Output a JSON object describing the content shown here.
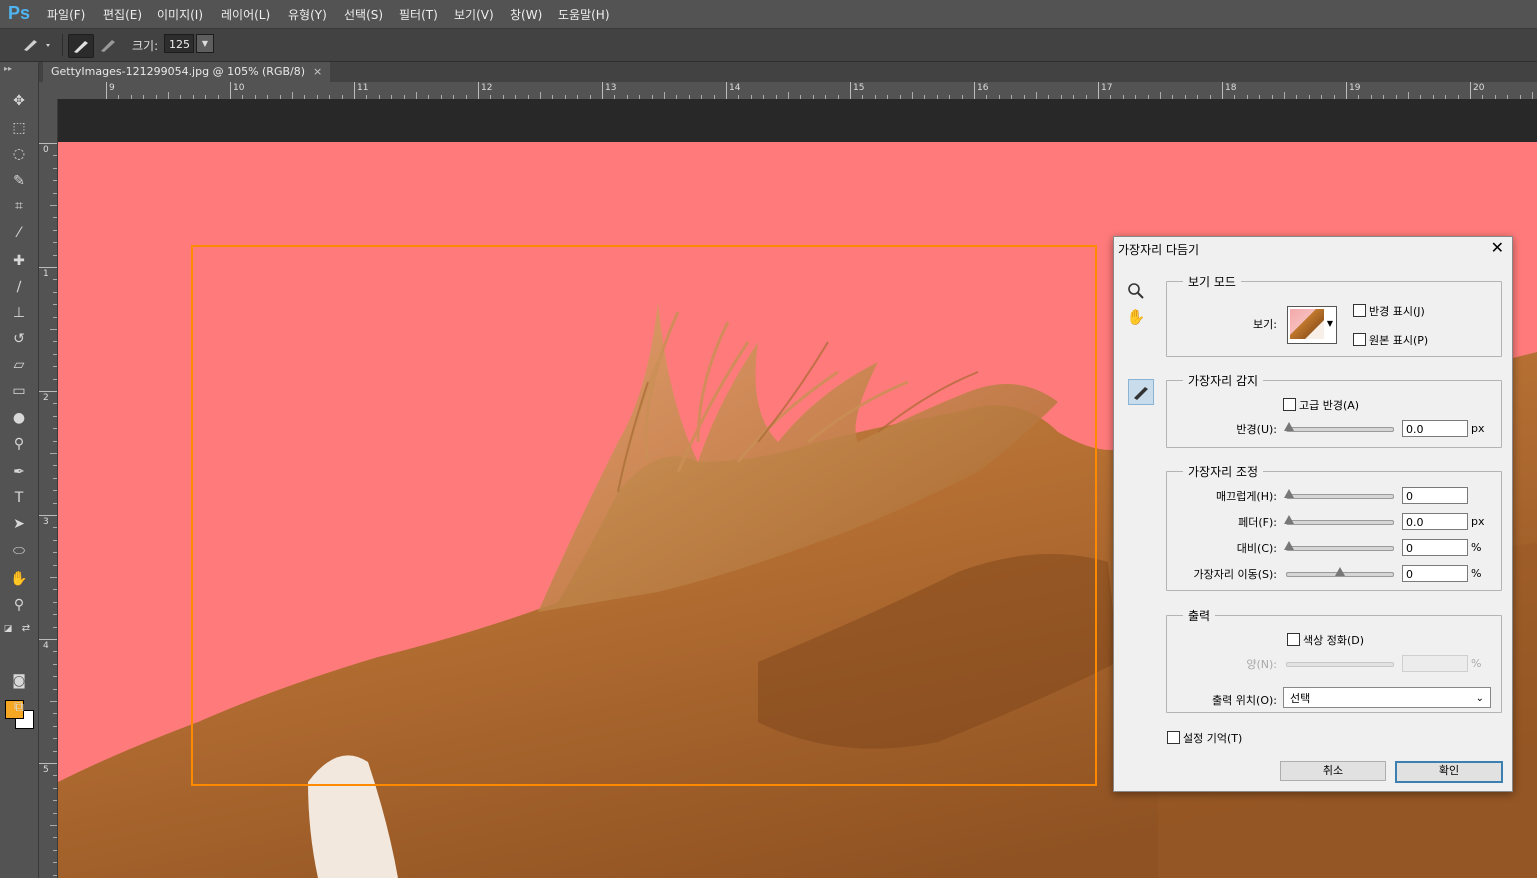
{
  "app": {
    "logo": "Ps"
  },
  "menu": [
    "파일(F)",
    "편집(E)",
    "이미지(I)",
    "레이어(L)",
    "유형(Y)",
    "선택(S)",
    "필터(T)",
    "보기(V)",
    "창(W)",
    "도움말(H)"
  ],
  "options": {
    "size_label": "크기:",
    "size_value": "125"
  },
  "document": {
    "tab_title": "GettyImages-121299054.jpg @ 105% (RGB/8)",
    "close_glyph": "×"
  },
  "ruler": {
    "top_labels": [
      "9",
      "10",
      "11",
      "12",
      "13",
      "14",
      "15",
      "16",
      "17",
      "18",
      "19",
      "20"
    ],
    "left_labels": [
      "0",
      "1",
      "2",
      "3",
      "4",
      "5"
    ]
  },
  "colors": {
    "canvas_overlay": "#ff7b7b",
    "selection": "#ff8a00",
    "foreground": "#f5a623",
    "background": "#ffffff"
  },
  "dialog": {
    "title": "가장자리 다듬기",
    "close_glyph": "✕",
    "view_mode": {
      "group_title": "보기 모드",
      "view_label": "보기:",
      "show_radius": "반경 표시(J)",
      "show_original": "원본 표시(P)"
    },
    "edge_detection": {
      "group_title": "가장자리 감지",
      "smart_radius": "고급 반경(A)",
      "radius_label": "반경(U):",
      "radius_value": "0.0",
      "radius_unit": "px"
    },
    "adjust_edge": {
      "group_title": "가장자리 조정",
      "smooth_label": "매끄럽게(H):",
      "smooth_value": "0",
      "feather_label": "페더(F):",
      "feather_value": "0.0",
      "feather_unit": "px",
      "contrast_label": "대비(C):",
      "contrast_value": "0",
      "contrast_unit": "%",
      "shift_label": "가장자리 이동(S):",
      "shift_value": "0",
      "shift_unit": "%"
    },
    "output": {
      "group_title": "출력",
      "decontaminate": "색상 정화(D)",
      "amount_label": "양(N):",
      "amount_unit": "%",
      "output_to_label": "출력 위치(O):",
      "output_to_value": "선택"
    },
    "remember": "설정 기억(T)",
    "cancel": "취소",
    "ok": "확인"
  }
}
